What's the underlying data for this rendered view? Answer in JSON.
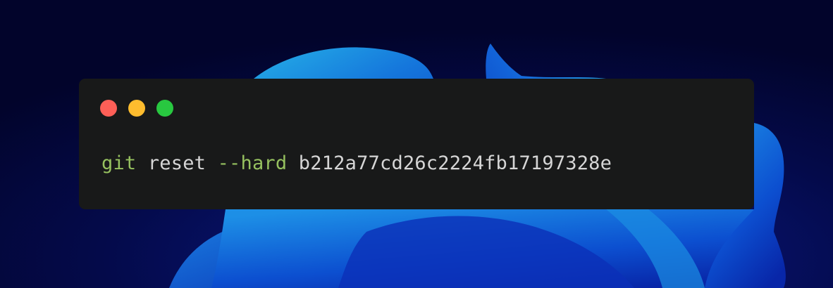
{
  "colors": {
    "background": "#030633",
    "window": "#181919",
    "close_dot": "#fe5f57",
    "minimize_dot": "#febc2e",
    "maximize_dot": "#28c840",
    "command_green": "#96c15f",
    "text_gray": "#d6d6d6"
  },
  "window_controls": {
    "close": "close-dot",
    "minimize": "minimize-dot",
    "maximize": "maximize-dot"
  },
  "code": {
    "command": "git",
    "subcommand": "reset",
    "flag": "--hard",
    "argument": "b212a77cd26c2224fb17197328e"
  }
}
